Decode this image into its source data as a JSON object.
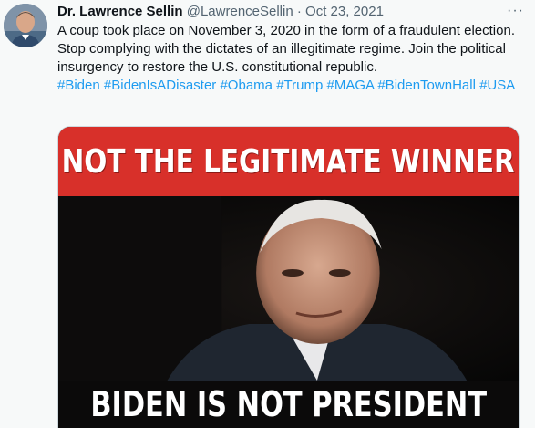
{
  "tweet": {
    "author_name": "Dr. Lawrence Sellin",
    "handle": "@LawrenceSellin",
    "separator": "·",
    "date": "Oct 23, 2021",
    "more_label": "···",
    "text": "A coup took place on November 3, 2020 in the form of a fraudulent election. Stop complying with the dictates of an illegitimate regime. Join the political insurgency to restore the U.S. constitutional republic.",
    "hashtags": [
      "#Biden",
      "#BidenIsADisaster",
      "#Obama",
      "#Trump",
      "#MAGA",
      "#BidenTownHall",
      "#USA"
    ]
  },
  "media": {
    "top_caption": "NOT THE LEGITIMATE WINNER",
    "bottom_caption": "BIDEN IS NOT PRESIDENT",
    "banner_color": "#d8302a"
  },
  "colors": {
    "link": "#1d9bf0",
    "secondary_text": "#536471",
    "background": "#f7f9f9"
  }
}
